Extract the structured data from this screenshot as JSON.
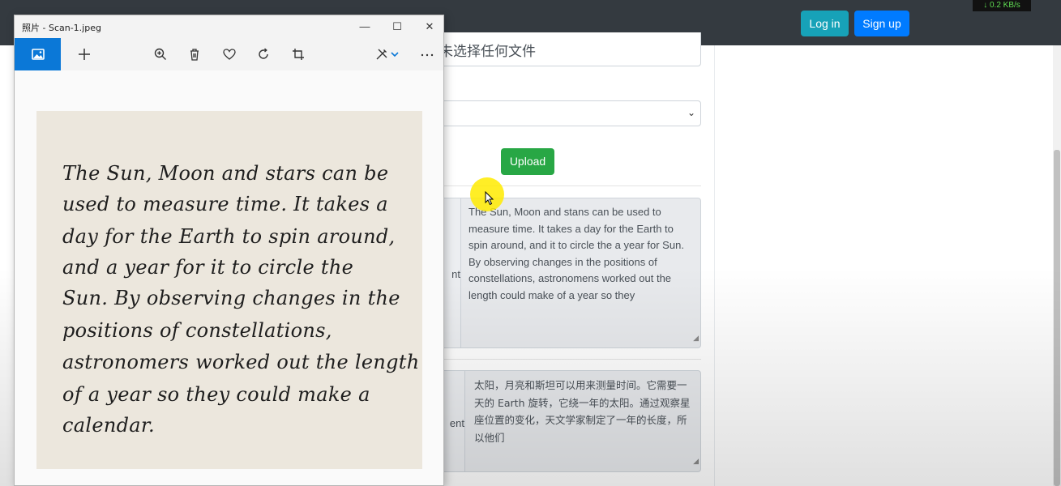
{
  "navbar": {
    "login_label": "Log in",
    "signup_label": "Sign up",
    "net_speed": "↓ 0.2 KB/s"
  },
  "form": {
    "file_input_text": "未选择任何文件",
    "upload_label": "Upload",
    "recognized_label": "nt",
    "recognized_text": "The Sun, Moon and stans can be used to measure time. It takes a day for the Earth to spin around, and it to circle the a year for Sun. By observing changes in the positions of constellations, astronomens worked out the length could make of a year so they",
    "translated_label": "ent",
    "translated_text": "太阳，月亮和斯坦可以用来测量时间。它需要一天的 Earth 旋转，它绕一年的太阳。通过观察星座位置的变化，天文学家制定了一年的长度，所以他们"
  },
  "photo_window": {
    "title": "照片 - Scan-1.jpeg",
    "toolbar_icons": [
      "image-icon",
      "add-icon",
      "zoom-in-icon",
      "delete-icon",
      "heart-icon",
      "rotate-icon",
      "crop-icon",
      "edit-icon",
      "more-icon"
    ],
    "handwriting_lines": [
      "The Sun, Moon and stars can be",
      "used to measure time. It takes a",
      "day for the Earth to spin around,",
      "and a year for it to circle the",
      "Sun. By observing changes in the",
      "positions of constellations,",
      "astronomers worked out the length",
      "of a year so they could make a",
      "calendar."
    ]
  },
  "colors": {
    "navbar": "#343a40",
    "login": "#17a2b8",
    "signup": "#007bff",
    "upload": "#28a745",
    "photos_accent": "#0b78d7"
  }
}
